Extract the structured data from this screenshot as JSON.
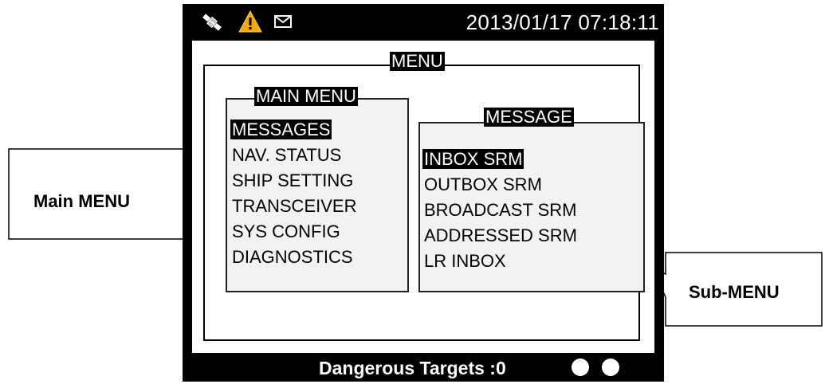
{
  "status_bar": {
    "icons": [
      "satellite-icon",
      "warning-icon",
      "mail-icon"
    ],
    "datetime": "2013/01/17 07:18:11"
  },
  "menu": {
    "title": "MENU",
    "main_menu": {
      "title": "MAIN MENU",
      "items": [
        "MESSAGES",
        "NAV. STATUS",
        "SHIP SETTING",
        "TRANSCEIVER",
        "SYS CONFIG",
        "DIAGNOSTICS"
      ],
      "selected": "MESSAGES"
    },
    "sub_menu": {
      "title": "MESSAGE",
      "items": [
        "INBOX SRM",
        "OUTBOX SRM",
        "BROADCAST SRM",
        "ADDRESSED SRM",
        "LR INBOX"
      ],
      "selected": "INBOX SRM"
    }
  },
  "footer": {
    "dangerous_targets": "Dangerous Targets :0",
    "indicators": 2
  },
  "callouts": {
    "main_menu_label": "Main MENU",
    "sub_menu_label": "Sub-MENU"
  },
  "colors": {
    "screen_bg": "#000000",
    "highlight_bg": "#000000",
    "highlight_text": "#ffffff",
    "panel_bg": "#f2f2f2",
    "warning_yellow": "#f5a800"
  }
}
